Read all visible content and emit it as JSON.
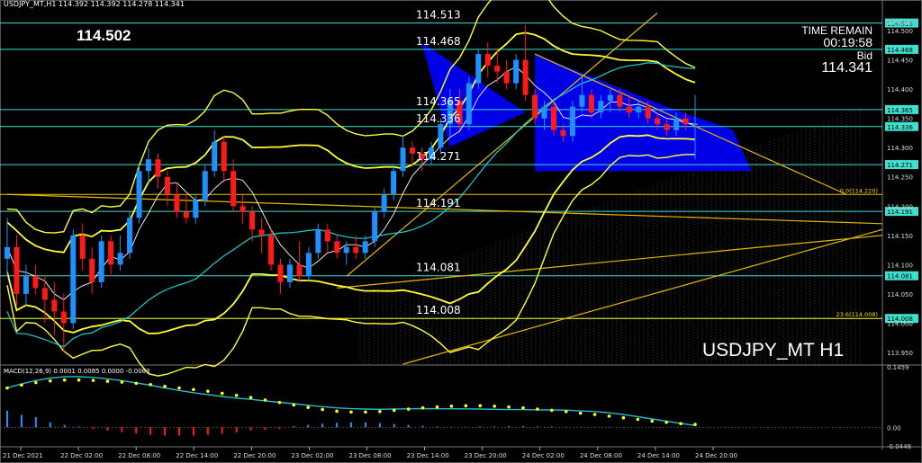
{
  "header": {
    "info": "USDJPY_MT,H1  114.392 114.392 114.278 114.341"
  },
  "big_price": "114.502",
  "time_remain": {
    "label": "TIME REMAIN",
    "value": "00:19:58"
  },
  "bid": {
    "label": "Bid",
    "value": "114.341"
  },
  "symbol_title": "USDJPY_MT H1",
  "macd_label": "MACD(12,26,9) 0.0001 0.0085 0.0000 -0.0083",
  "colors": {
    "bull": "#1e90ff",
    "bear": "#ff1a1a",
    "level_line": "#40e0d0",
    "band": "#ffff33",
    "trend": "#e6b800",
    "fill": "#0000ff"
  },
  "chart_data": {
    "type": "candlestick",
    "symbol": "USDJPY_MT",
    "timeframe": "H1",
    "ylim": [
      113.93,
      114.54
    ],
    "y_ticks": [
      "114.515",
      "114.500",
      "114.450",
      "114.400",
      "114.350",
      "114.300",
      "114.250",
      "114.200",
      "114.150",
      "114.100",
      "114.050",
      "114.000",
      "113.950"
    ],
    "x_ticks": [
      "21 Dec 2021",
      "22 Dec 02:00",
      "22 Dec 08:00",
      "22 Dec 14:00",
      "22 Dec 20:00",
      "23 Dec 02:00",
      "23 Dec 08:00",
      "23 Dec 14:00",
      "23 Dec 20:00",
      "24 Dec 02:00",
      "24 Dec 08:00",
      "24 Dec 14:00",
      "24 Dec 20:00"
    ],
    "price_levels": [
      {
        "label": "114.513",
        "value": 114.513
      },
      {
        "label": "114.468",
        "value": 114.468
      },
      {
        "label": "114.365",
        "value": 114.365
      },
      {
        "label": "114.336",
        "value": 114.336
      },
      {
        "label": "114.271",
        "value": 114.271
      },
      {
        "label": "114.191",
        "value": 114.191
      },
      {
        "label": "114.081",
        "value": 114.081
      },
      {
        "label": "114.008",
        "value": 114.008
      }
    ],
    "axis_price_tags": [
      "114.513",
      "114.468",
      "114.365",
      "114.336",
      "114.271",
      "114.191",
      "114.081",
      "114.008"
    ],
    "fib_levels": [
      {
        "label": "0.0(114.220)",
        "value": 114.22
      },
      {
        "label": "23.6(114.008)",
        "value": 114.008
      }
    ],
    "candles": [
      {
        "o": 114.11,
        "h": 114.18,
        "l": 114.08,
        "c": 114.13
      },
      {
        "o": 114.13,
        "h": 114.15,
        "l": 114.03,
        "c": 114.05
      },
      {
        "o": 114.05,
        "h": 114.1,
        "l": 114.03,
        "c": 114.08
      },
      {
        "o": 114.08,
        "h": 114.1,
        "l": 114.05,
        "c": 114.06
      },
      {
        "o": 114.06,
        "h": 114.08,
        "l": 114.0,
        "c": 114.04
      },
      {
        "o": 114.04,
        "h": 114.07,
        "l": 113.98,
        "c": 114.02
      },
      {
        "o": 114.02,
        "h": 114.05,
        "l": 113.95,
        "c": 114.0
      },
      {
        "o": 114.0,
        "h": 114.16,
        "l": 113.99,
        "c": 114.15
      },
      {
        "o": 114.15,
        "h": 114.17,
        "l": 114.09,
        "c": 114.11
      },
      {
        "o": 114.11,
        "h": 114.13,
        "l": 114.05,
        "c": 114.07
      },
      {
        "o": 114.07,
        "h": 114.15,
        "l": 114.06,
        "c": 114.14
      },
      {
        "o": 114.14,
        "h": 114.15,
        "l": 114.08,
        "c": 114.1
      },
      {
        "o": 114.1,
        "h": 114.15,
        "l": 114.09,
        "c": 114.12
      },
      {
        "o": 114.12,
        "h": 114.19,
        "l": 114.11,
        "c": 114.18
      },
      {
        "o": 114.18,
        "h": 114.27,
        "l": 114.17,
        "c": 114.26
      },
      {
        "o": 114.26,
        "h": 114.3,
        "l": 114.24,
        "c": 114.28
      },
      {
        "o": 114.28,
        "h": 114.29,
        "l": 114.23,
        "c": 114.25
      },
      {
        "o": 114.25,
        "h": 114.26,
        "l": 114.2,
        "c": 114.22
      },
      {
        "o": 114.22,
        "h": 114.24,
        "l": 114.18,
        "c": 114.19
      },
      {
        "o": 114.19,
        "h": 114.22,
        "l": 114.17,
        "c": 114.18
      },
      {
        "o": 114.18,
        "h": 114.22,
        "l": 114.17,
        "c": 114.21
      },
      {
        "o": 114.21,
        "h": 114.27,
        "l": 114.2,
        "c": 114.26
      },
      {
        "o": 114.26,
        "h": 114.33,
        "l": 114.25,
        "c": 114.31
      },
      {
        "o": 114.31,
        "h": 114.32,
        "l": 114.24,
        "c": 114.26
      },
      {
        "o": 114.26,
        "h": 114.28,
        "l": 114.19,
        "c": 114.2
      },
      {
        "o": 114.2,
        "h": 114.22,
        "l": 114.17,
        "c": 114.19
      },
      {
        "o": 114.19,
        "h": 114.2,
        "l": 114.14,
        "c": 114.16
      },
      {
        "o": 114.16,
        "h": 114.18,
        "l": 114.12,
        "c": 114.15
      },
      {
        "o": 114.15,
        "h": 114.16,
        "l": 114.09,
        "c": 114.1
      },
      {
        "o": 114.1,
        "h": 114.11,
        "l": 114.05,
        "c": 114.07
      },
      {
        "o": 114.07,
        "h": 114.11,
        "l": 114.06,
        "c": 114.1
      },
      {
        "o": 114.1,
        "h": 114.14,
        "l": 114.07,
        "c": 114.08
      },
      {
        "o": 114.08,
        "h": 114.13,
        "l": 114.07,
        "c": 114.12
      },
      {
        "o": 114.12,
        "h": 114.17,
        "l": 114.11,
        "c": 114.16
      },
      {
        "o": 114.16,
        "h": 114.17,
        "l": 114.12,
        "c": 114.14
      },
      {
        "o": 114.14,
        "h": 114.15,
        "l": 114.11,
        "c": 114.12
      },
      {
        "o": 114.12,
        "h": 114.14,
        "l": 114.1,
        "c": 114.13
      },
      {
        "o": 114.13,
        "h": 114.15,
        "l": 114.11,
        "c": 114.12
      },
      {
        "o": 114.12,
        "h": 114.15,
        "l": 114.11,
        "c": 114.14
      },
      {
        "o": 114.14,
        "h": 114.2,
        "l": 114.13,
        "c": 114.19
      },
      {
        "o": 114.19,
        "h": 114.23,
        "l": 114.18,
        "c": 114.22
      },
      {
        "o": 114.22,
        "h": 114.27,
        "l": 114.21,
        "c": 114.26
      },
      {
        "o": 114.26,
        "h": 114.32,
        "l": 114.25,
        "c": 114.3
      },
      {
        "o": 114.3,
        "h": 114.31,
        "l": 114.27,
        "c": 114.29
      },
      {
        "o": 114.29,
        "h": 114.3,
        "l": 114.26,
        "c": 114.28
      },
      {
        "o": 114.28,
        "h": 114.31,
        "l": 114.27,
        "c": 114.3
      },
      {
        "o": 114.3,
        "h": 114.35,
        "l": 114.29,
        "c": 114.34
      },
      {
        "o": 114.34,
        "h": 114.4,
        "l": 114.32,
        "c": 114.38
      },
      {
        "o": 114.38,
        "h": 114.4,
        "l": 114.33,
        "c": 114.34
      },
      {
        "o": 114.34,
        "h": 114.42,
        "l": 114.33,
        "c": 114.41
      },
      {
        "o": 114.41,
        "h": 114.47,
        "l": 114.4,
        "c": 114.46
      },
      {
        "o": 114.46,
        "h": 114.48,
        "l": 114.42,
        "c": 114.44
      },
      {
        "o": 114.44,
        "h": 114.47,
        "l": 114.41,
        "c": 114.43
      },
      {
        "o": 114.43,
        "h": 114.45,
        "l": 114.4,
        "c": 114.41
      },
      {
        "o": 114.41,
        "h": 114.46,
        "l": 114.4,
        "c": 114.45
      },
      {
        "o": 114.45,
        "h": 114.51,
        "l": 114.38,
        "c": 114.39
      },
      {
        "o": 114.39,
        "h": 114.4,
        "l": 114.34,
        "c": 114.35
      },
      {
        "o": 114.35,
        "h": 114.38,
        "l": 114.33,
        "c": 114.37
      },
      {
        "o": 114.37,
        "h": 114.38,
        "l": 114.32,
        "c": 114.33
      },
      {
        "o": 114.33,
        "h": 114.34,
        "l": 114.31,
        "c": 114.32
      },
      {
        "o": 114.32,
        "h": 114.38,
        "l": 114.31,
        "c": 114.37
      },
      {
        "o": 114.37,
        "h": 114.42,
        "l": 114.36,
        "c": 114.39
      },
      {
        "o": 114.39,
        "h": 114.4,
        "l": 114.35,
        "c": 114.36
      },
      {
        "o": 114.36,
        "h": 114.39,
        "l": 114.35,
        "c": 114.38
      },
      {
        "o": 114.38,
        "h": 114.4,
        "l": 114.36,
        "c": 114.39
      },
      {
        "o": 114.39,
        "h": 114.4,
        "l": 114.36,
        "c": 114.37
      },
      {
        "o": 114.37,
        "h": 114.39,
        "l": 114.35,
        "c": 114.36
      },
      {
        "o": 114.36,
        "h": 114.38,
        "l": 114.35,
        "c": 114.37
      },
      {
        "o": 114.37,
        "h": 114.38,
        "l": 114.34,
        "c": 114.35
      },
      {
        "o": 114.35,
        "h": 114.36,
        "l": 114.33,
        "c": 114.34
      },
      {
        "o": 114.34,
        "h": 114.35,
        "l": 114.32,
        "c": 114.33
      },
      {
        "o": 114.33,
        "h": 114.36,
        "l": 114.32,
        "c": 114.35
      },
      {
        "o": 114.35,
        "h": 114.36,
        "l": 114.33,
        "c": 114.34
      },
      {
        "o": 114.34,
        "h": 114.39,
        "l": 114.28,
        "c": 114.341
      }
    ],
    "macd": {
      "ylim": [
        -0.0448,
        0.1459
      ],
      "y_ticks": [
        "0.1459",
        "0.00",
        "-0.0448"
      ],
      "signal": [
        0.095,
        0.102,
        0.108,
        0.112,
        0.114,
        0.114,
        0.113,
        0.111,
        0.109,
        0.106,
        0.103,
        0.099,
        0.095,
        0.091,
        0.087,
        0.082,
        0.077,
        0.072,
        0.066,
        0.06,
        0.054,
        0.048,
        0.043,
        0.039,
        0.037,
        0.037,
        0.038,
        0.041,
        0.044,
        0.047,
        0.049,
        0.051,
        0.052,
        0.052,
        0.051,
        0.049,
        0.047,
        0.044,
        0.041,
        0.038,
        0.034,
        0.031,
        0.027,
        0.023,
        0.019,
        0.015,
        0.012,
        0.009,
        0.007
      ],
      "histogram": [
        0.04,
        0.03,
        0.025,
        0.012,
        0.006,
        0.002,
        -0.004,
        -0.008,
        -0.012,
        -0.015,
        -0.018,
        -0.02,
        -0.02,
        -0.02,
        -0.018,
        -0.016,
        -0.012,
        -0.008,
        -0.006,
        -0.004,
        0.003,
        0.006,
        0.009,
        0.011,
        0.012,
        0.012,
        0.01,
        0.008,
        0.006,
        0.004,
        0.002,
        0.001,
        0.001,
        0.002,
        0.002,
        0.003,
        0.003,
        0.002,
        0.002,
        0.001,
        0.001,
        0.001,
        0.001,
        0.0,
        0.0,
        0.0,
        0.0,
        0.0,
        0.0001
      ]
    }
  }
}
